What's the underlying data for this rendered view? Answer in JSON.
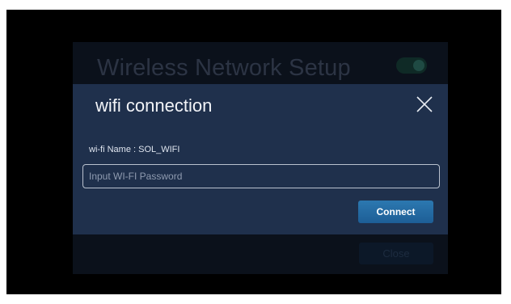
{
  "background_screen": {
    "title": "Wireless Network Setup",
    "toggle_state": "on",
    "close_label": "Close"
  },
  "dialog": {
    "title": "wifi connection",
    "close_icon": "close-icon",
    "wifi_name_label": "wi-fi Name : SOL_WIFI",
    "password_value": "",
    "password_placeholder": "Input WI-FI Password",
    "connect_label": "Connect"
  },
  "colors": {
    "dialog_bg": "#1f304c",
    "accent_button": "#2468a2",
    "overlay": "#000000"
  }
}
